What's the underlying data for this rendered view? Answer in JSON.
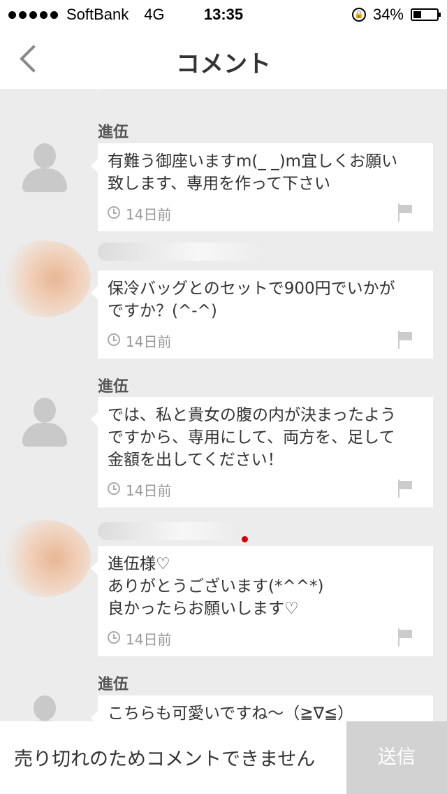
{
  "status_bar": {
    "carrier": "SoftBank",
    "network": "4G",
    "time": "13:35",
    "battery": "34%",
    "battery_level": 0.34
  },
  "nav": {
    "title": "コメント",
    "back_icon": "chevron-left-icon"
  },
  "comments": [
    {
      "user": "進伍",
      "text": "有難う御座いますm(_ _)m宜しくお願い\n致します、専用を作って下さい",
      "time": "14日前"
    },
    {
      "user": "",
      "text": "保冷バッグとのセットで900円でいかが\nですか？(^-^)",
      "time": "14日前"
    },
    {
      "user": "進伍",
      "text": "では、私と貴女の腹の内が決まったよう\nですから、専用にして、両方を、足して\n金額を出してください！",
      "time": "14日前"
    },
    {
      "user": "",
      "text": "進伍様♡\nありがとうございます(*^^*)\n良かったらお願いします♡",
      "time": "14日前"
    },
    {
      "user": "進伍",
      "text": "こちらも可愛いですね〜（≧∇≦）",
      "time": ""
    }
  ],
  "bottom": {
    "sold_out_text": "売り切れのためコメントできません",
    "send_label": "送信"
  }
}
